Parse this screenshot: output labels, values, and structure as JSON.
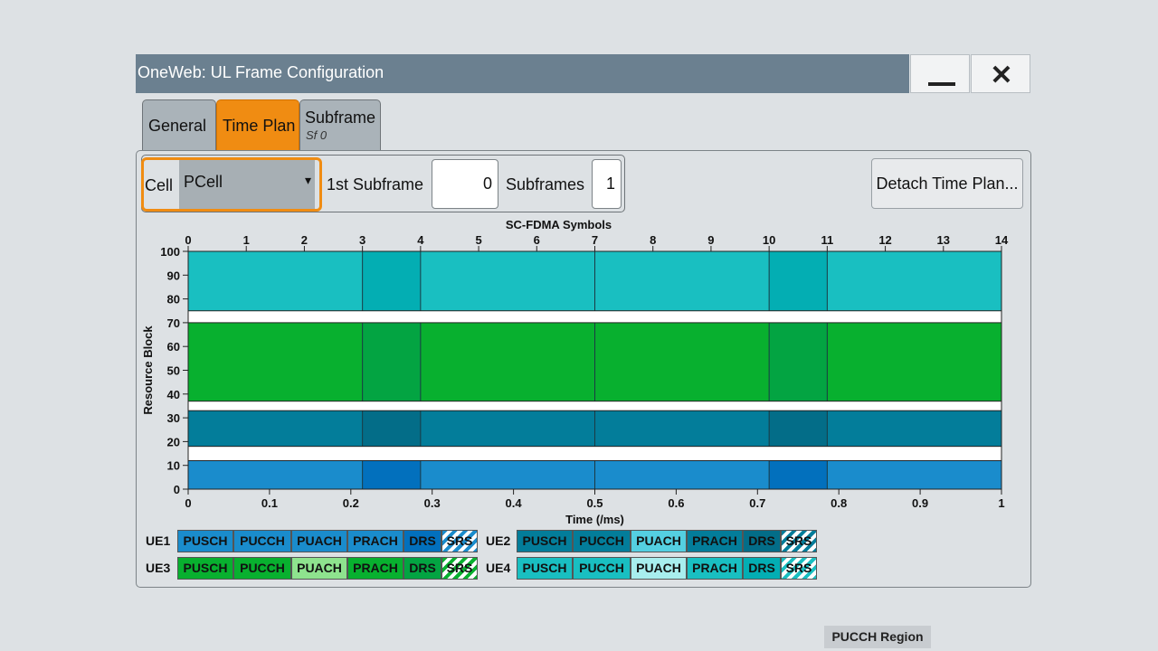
{
  "window": {
    "title": "OneWeb: UL Frame Configuration"
  },
  "tabs": {
    "general": "General",
    "time_plan": "Time Plan",
    "subframe": "Subframe",
    "subframe_sub": "Sf 0"
  },
  "controls": {
    "cell_label": "Cell",
    "cell_value": "PCell",
    "first_subframe_label": "1st Subframe",
    "first_subframe_value": "0",
    "subframes_label": "Subframes",
    "subframes_value": "1",
    "detach_button": "Detach Time Plan..."
  },
  "chart_data": {
    "type": "heatmap",
    "top_axis_label": "SC-FDMA Symbols",
    "xlabel": "Time (/ms)",
    "ylabel": "Resource Block",
    "top_ticks": [
      "0",
      "1",
      "2",
      "3",
      "4",
      "5",
      "6",
      "7",
      "8",
      "9",
      "10",
      "11",
      "12",
      "13",
      "14"
    ],
    "bottom_ticks": [
      "0",
      "0.1",
      "0.2",
      "0.3",
      "0.4",
      "0.5",
      "0.6",
      "0.7",
      "0.8",
      "0.9",
      "1"
    ],
    "y_ticks": [
      "0",
      "10",
      "20",
      "30",
      "40",
      "50",
      "60",
      "70",
      "80",
      "90",
      "100"
    ],
    "xlim_symbols": [
      0,
      14
    ],
    "ylim": [
      0,
      100
    ],
    "drs_symbols": [
      3,
      10
    ],
    "bands": [
      {
        "ue": "UE4",
        "rb_start": 75,
        "rb_end": 100,
        "color": "#19bfc1",
        "drs_color": "#03aeb3"
      },
      {
        "ue": "UE3",
        "rb_start": 37,
        "rb_end": 70,
        "color": "#08b02f",
        "drs_color": "#03a442"
      },
      {
        "ue": "UE2",
        "rb_start": 18,
        "rb_end": 33,
        "color": "#037d9a",
        "drs_color": "#036d88"
      },
      {
        "ue": "UE1",
        "rb_start": 0,
        "rb_end": 12,
        "color": "#1a8ccc",
        "drs_color": "#0270bd"
      }
    ]
  },
  "legend": {
    "items": [
      "PUSCH",
      "PUCCH",
      "PUACH",
      "PRACH",
      "DRS",
      "SRS"
    ],
    "pucch_region": "PUCCH Region",
    "ues": [
      {
        "name": "UE1",
        "colors": [
          "#1a8ccc",
          "#1a8ccc",
          "#1a8ccc",
          "#1a8ccc",
          "#0270bd",
          "#1a8ccc"
        ]
      },
      {
        "name": "UE2",
        "colors": [
          "#037d9a",
          "#037d9a",
          "#54cfe1",
          "#037d9a",
          "#036d88",
          "#037d9a"
        ]
      },
      {
        "name": "UE3",
        "colors": [
          "#08b02f",
          "#08b02f",
          "#8ee38e",
          "#08b02f",
          "#03a442",
          "#08b02f"
        ]
      },
      {
        "name": "UE4",
        "colors": [
          "#19bfc1",
          "#19bfc1",
          "#a8eeee",
          "#19bfc1",
          "#03aeb3",
          "#19bfc1"
        ]
      }
    ]
  }
}
